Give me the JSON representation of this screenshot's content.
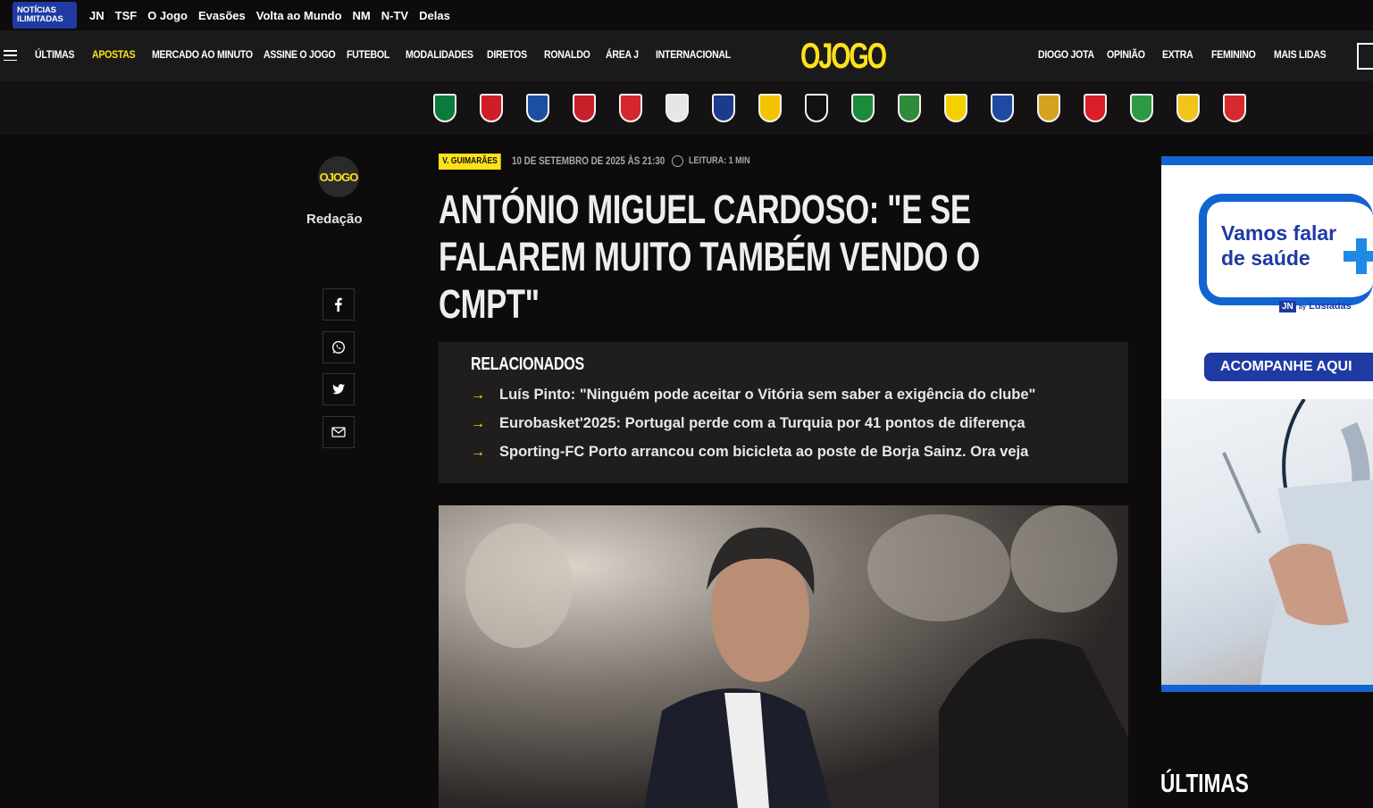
{
  "network_bar": {
    "badge_line1": "NOTÍCIAS",
    "badge_line2": "ILIMITADAS",
    "links": [
      "JN",
      "TSF",
      "O Jogo",
      "Evasões",
      "Volta ao Mundo",
      "NM",
      "N-TV",
      "Delas"
    ]
  },
  "main_nav": {
    "left_items": [
      "ÚLTIMAS",
      "APOSTAS",
      "MERCADO AO MINUTO",
      "ASSINE O JOGO",
      "FUTEBOL",
      "MODALIDADES",
      "DIRETOS",
      "RONALDO",
      "ÁREA J",
      "INTERNACIONAL"
    ],
    "highlight_item": "APOSTAS",
    "logo_o": "O",
    "logo_text": "JOGO",
    "right_items": [
      "DIOGO JOTA",
      "OPINIÃO",
      "EXTRA",
      "FEMININO",
      "MAIS LIDAS"
    ]
  },
  "club_crests": [
    {
      "name": "sporting-crest",
      "color": "#0b7a3b"
    },
    {
      "name": "benfica-crest",
      "color": "#d01d27"
    },
    {
      "name": "porto-crest",
      "color": "#1d4fa0"
    },
    {
      "name": "braga-crest",
      "color": "#c8202a"
    },
    {
      "name": "gil-vicente-crest",
      "color": "#d6262f"
    },
    {
      "name": "vitoria-crest",
      "color": "#e6e6e6"
    },
    {
      "name": "famalicao-crest",
      "color": "#1c3b8c"
    },
    {
      "name": "estoril-crest",
      "color": "#f3c300"
    },
    {
      "name": "casa-pia-crest",
      "color": "#111111"
    },
    {
      "name": "moreirense-crest",
      "color": "#1a8b3c"
    },
    {
      "name": "rio-ave-crest",
      "color": "#2e8b3a"
    },
    {
      "name": "arouca-crest",
      "color": "#f3d100"
    },
    {
      "name": "nacional-crest",
      "color": "#1f4aa0"
    },
    {
      "name": "estrela-crest",
      "color": "#d4a21e"
    },
    {
      "name": "santa-clara-crest",
      "color": "#d81e27"
    },
    {
      "name": "tondela-crest",
      "color": "#2e9a44"
    },
    {
      "name": "alverca-crest",
      "color": "#f0c419"
    },
    {
      "name": "afs-crest",
      "color": "#d52a2f"
    }
  ],
  "author": {
    "logo_o": "O",
    "logo_text": "JOGO",
    "name": "Redação"
  },
  "share_buttons": [
    "facebook-icon",
    "whatsapp-icon",
    "twitter-icon",
    "email-icon"
  ],
  "article": {
    "tag": "V. GUIMARÃES",
    "date": "10 DE SETEMBRO DE 2025 ÀS 21:30",
    "reading_time": "LEITURA: 1 MIN",
    "headline": "ANTÓNIO MIGUEL CARDOSO: \"E SE FALAREM MUITO TAMBÉM VENDO O CMPT\""
  },
  "related": {
    "title": "RELACIONADOS",
    "items": [
      "Luís Pinto: \"Ninguém pode aceitar o Vitória sem saber a exigência do clube\"",
      "Eurobasket'2025: Portugal perde com a Turquia por 41 pontos de diferença",
      "Sporting-FC Porto arrancou com bicicleta ao poste de Borja Sainz. Ora veja"
    ]
  },
  "ad": {
    "line1": "Vamos falar",
    "line2": "de saúde",
    "brand_jn": "JN",
    "brand_by": "by",
    "brand_name": "Lusíadas",
    "cta": "ACOMPANHE AQUI"
  },
  "sidebar": {
    "ultimas_title": "ÚLTIMAS"
  }
}
